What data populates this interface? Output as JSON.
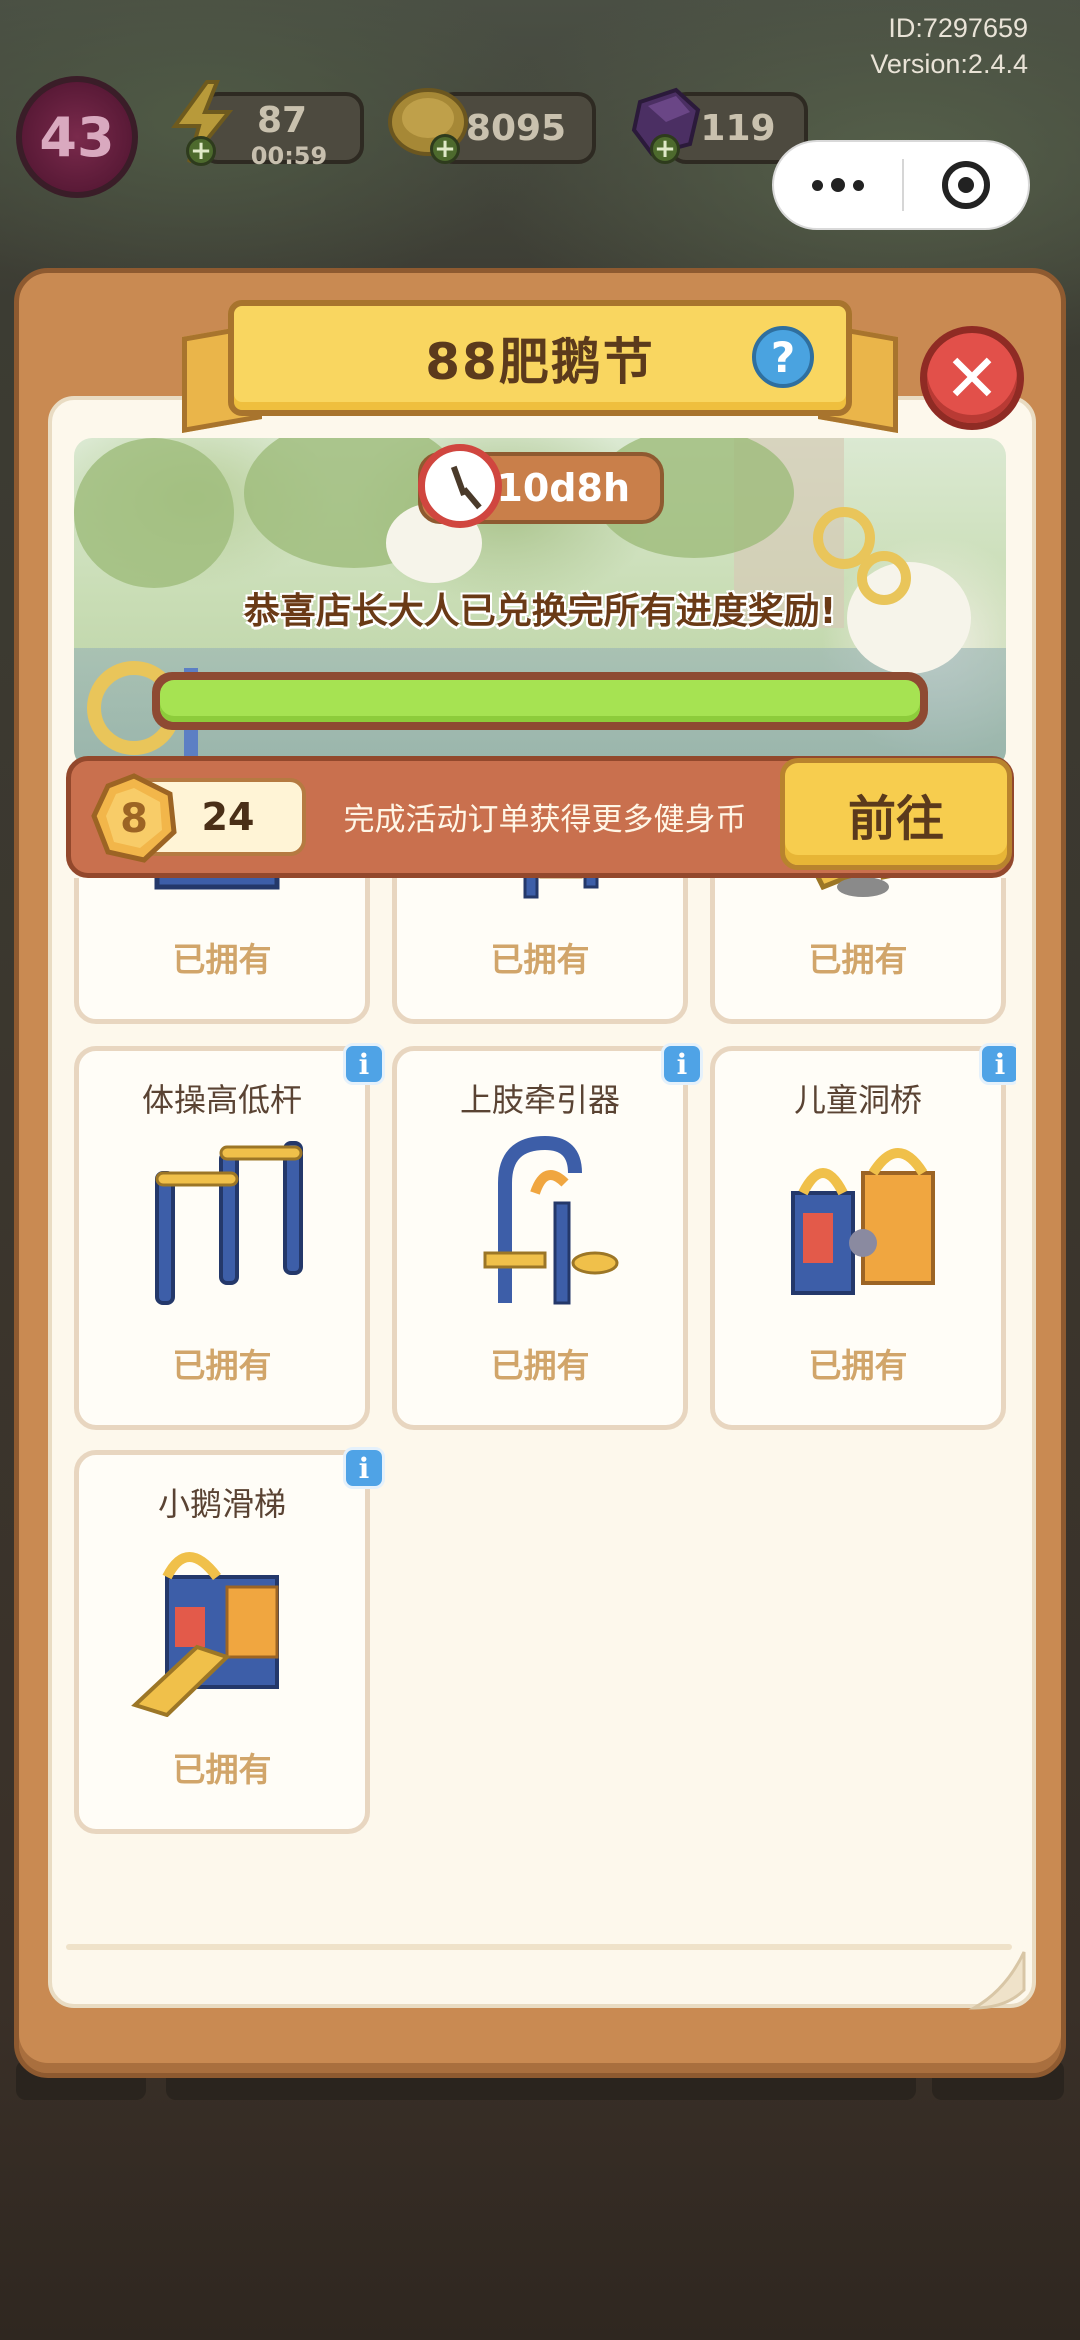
{
  "system": {
    "id": "ID:7297659",
    "version": "Version:2.4.4"
  },
  "hud": {
    "level": "43",
    "energy": "87",
    "energy_timer": "00:59",
    "coins": "8095",
    "gems": "119"
  },
  "event": {
    "title": "88肥鹅节",
    "help_label": "?",
    "close_label": "✕",
    "timer": "10d8h",
    "congrats": "恭喜店长大人已兑换完所有进度奖励!",
    "progress": 1.0
  },
  "coin_bar": {
    "count": "24",
    "coin_symbol": "8",
    "description": "完成活动订单获得更多健身币",
    "go_label": "前往"
  },
  "items": [
    {
      "name": "",
      "status": "已拥有",
      "art": "treadmill-icon"
    },
    {
      "name": "",
      "status": "已拥有",
      "art": "rope-frame-icon"
    },
    {
      "name": "",
      "status": "已拥有",
      "art": "seesaw-icon"
    },
    {
      "name": "体操高低杆",
      "status": "已拥有",
      "art": "uneven-bars-icon",
      "info": "i"
    },
    {
      "name": "上肢牵引器",
      "status": "已拥有",
      "art": "upper-limb-tractor-icon",
      "info": "i"
    },
    {
      "name": "儿童洞桥",
      "status": "已拥有",
      "art": "kids-tunnel-bridge-icon",
      "info": "i"
    },
    {
      "name": "小鹅滑梯",
      "status": "已拥有",
      "art": "goose-slide-icon",
      "info": "i"
    }
  ],
  "colors": {
    "panel": "#c98a52",
    "banner": "#f9d660",
    "progress_fill": "#a6e352",
    "close_red": "#e2504a",
    "owned_text": "#d1a56a"
  }
}
